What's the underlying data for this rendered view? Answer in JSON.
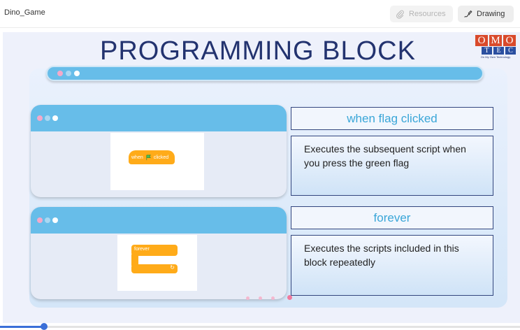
{
  "app": {
    "title": "Dino_Game"
  },
  "toolbar": {
    "resources_label": "Resources",
    "drawing_label": "Drawing"
  },
  "slide": {
    "title": "PROGRAMMING BLOCK",
    "logo": {
      "letters_top": [
        "O",
        "M",
        "O"
      ],
      "letters_bottom": [
        "T",
        "E",
        "C"
      ],
      "tagline": "On My Own Technology"
    },
    "blocks": [
      {
        "name": "when flag clicked",
        "block_text_1": "when",
        "block_text_2": "clicked",
        "description": "Executes the subsequent script when you press the green flag"
      },
      {
        "name": "forever",
        "block_text_1": "forever",
        "description": "Executes the scripts included in this block repeatedly"
      }
    ]
  },
  "progress": {
    "fraction": 0.085
  },
  "colors": {
    "accent": "#67bde9",
    "title": "#23336f",
    "block": "#ffab19",
    "box_title": "#3aa6d8"
  }
}
